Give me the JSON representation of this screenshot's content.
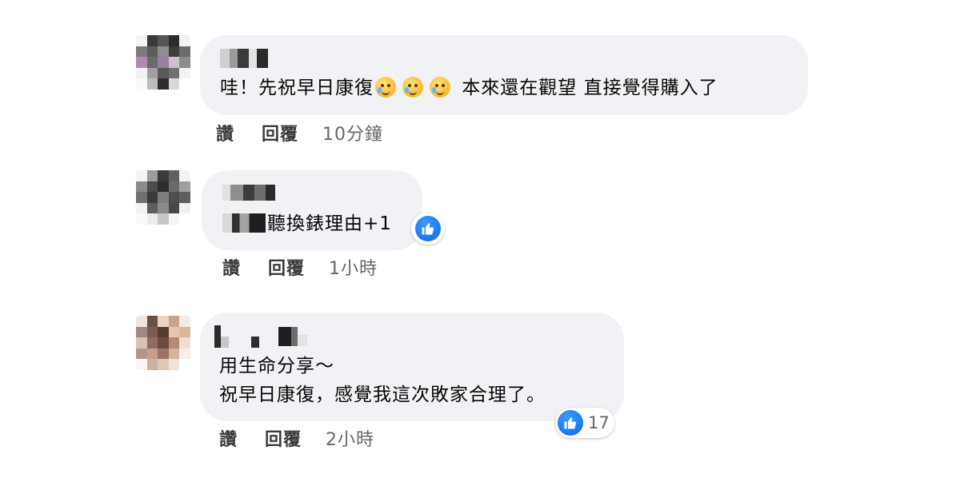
{
  "comments": [
    {
      "text_line_1": "哇！先祝早日康復",
      "text_line_1_after": " 本來還在觀望 直接覺得購入了",
      "emoji_count": 3,
      "emoji_name": "crying-smile-emoji",
      "like_label": "讚",
      "reply_label": "回覆",
      "time": "10分鐘"
    },
    {
      "text_line_1": "聽換錶理由+1",
      "like_label": "讚",
      "reply_label": "回覆",
      "time": "1小時",
      "reaction_icon": "thumbs-up-icon"
    },
    {
      "text_line_1": "用生命分享～",
      "text_line_2": "祝早日康復，感覺我這次敗家合理了。",
      "like_label": "讚",
      "reply_label": "回覆",
      "time": "2小時",
      "reaction_icon": "thumbs-up-icon",
      "reaction_count": "17"
    }
  ],
  "colors": {
    "bubble": "#f0f2f5",
    "like_blue": "#1877f2",
    "meta_gray": "#65676b"
  }
}
